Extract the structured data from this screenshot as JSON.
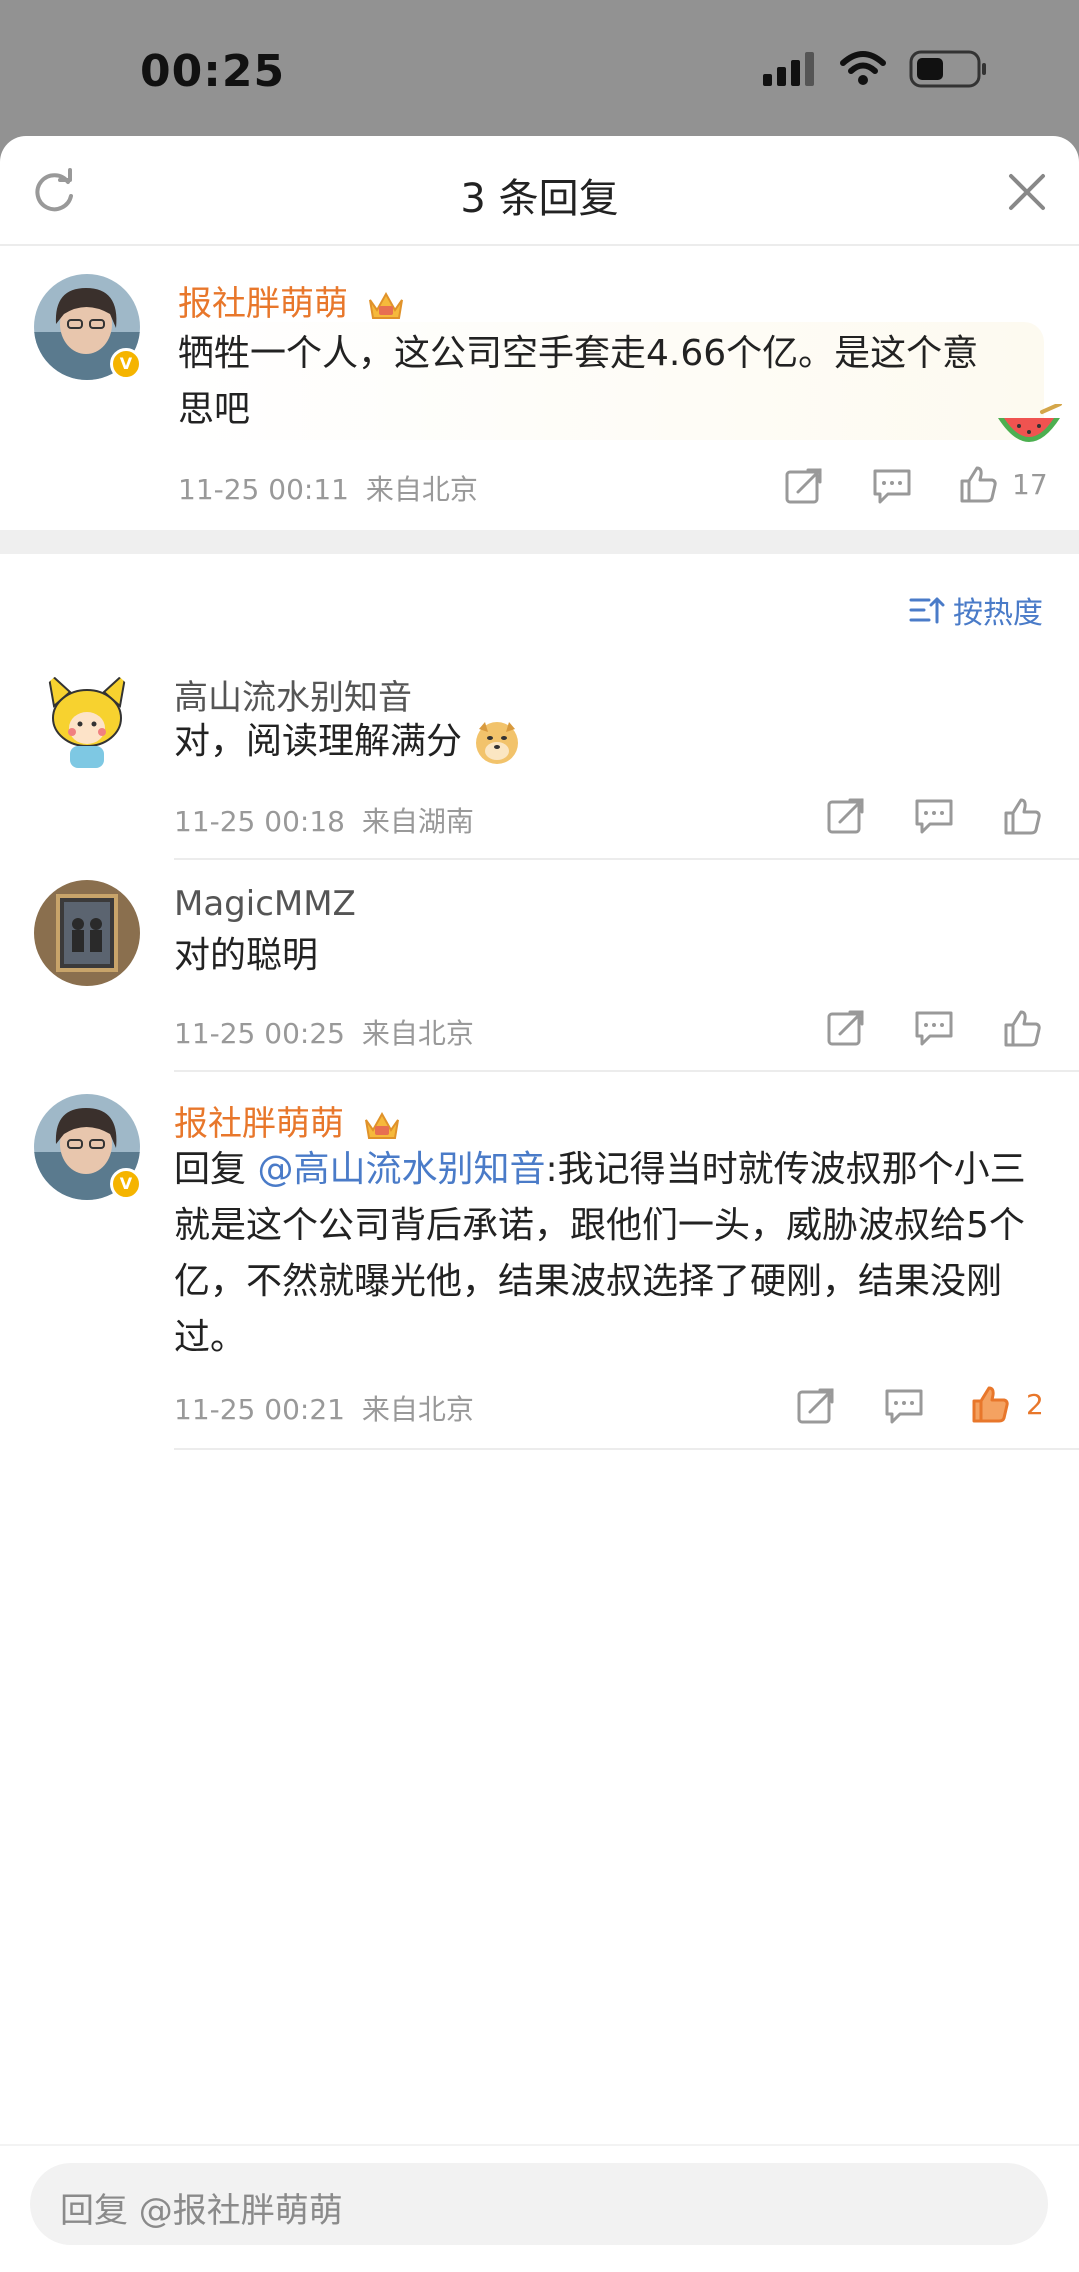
{
  "status_bar": {
    "time": "00:25"
  },
  "header": {
    "title": "3 条回复"
  },
  "main_comment": {
    "username": "报社胖萌萌",
    "text": "牺牲一个人，这公司空手套走4.66个亿。是这个意思吧",
    "time": "11-25 00:11",
    "location": "来自北京",
    "likes": "17"
  },
  "sort": {
    "label": "按热度"
  },
  "replies": [
    {
      "username": "高山流水别知音",
      "text": "对，阅读理解满分",
      "time": "11-25 00:18",
      "location": "来自湖南"
    },
    {
      "username": "MagicMMZ",
      "text": "对的聪明",
      "time": "11-25 00:25",
      "location": "来自北京"
    },
    {
      "username": "报社胖萌萌",
      "reply_prefix": "回复",
      "mention": "@高山流水别知音",
      "text": ":我记得当时就传波叔那个小三就是这个公司背后承诺，跟他们一头，威胁波叔给5个亿，不然就曝光他，结果波叔选择了硬刚，结果没刚过。",
      "time": "11-25 00:21",
      "location": "来自北京",
      "likes": "2"
    }
  ],
  "reply_input": {
    "placeholder": "回复 @报社胖萌萌"
  },
  "colors": {
    "accent_orange": "#e8772b",
    "link_blue": "#4a7bc8",
    "meta_gray": "#999999"
  }
}
